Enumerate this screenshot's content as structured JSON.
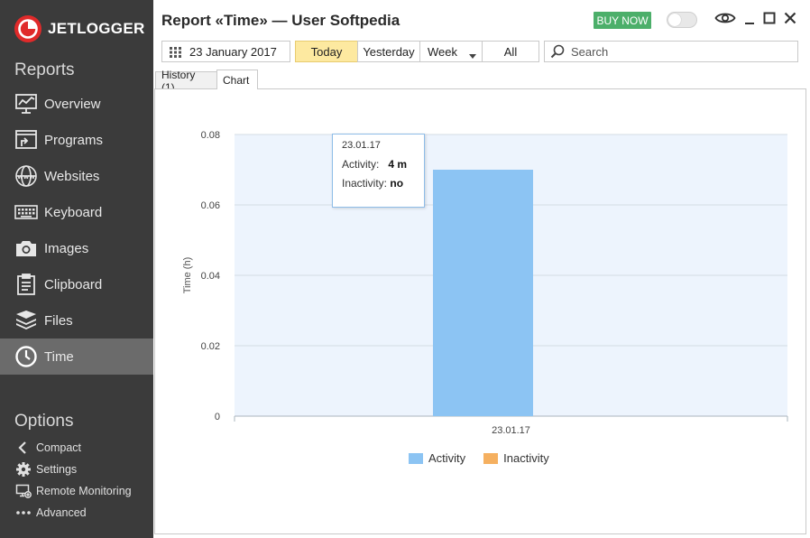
{
  "app": {
    "brand": "JETLOGGER",
    "window_title": "Report «Time» — User Softpedia",
    "buy_now": "BUY NOW"
  },
  "sidebar": {
    "reports_title": "Reports",
    "items": [
      {
        "label": "Overview",
        "icon": "overview-icon",
        "active": false
      },
      {
        "label": "Programs",
        "icon": "programs-icon",
        "active": false
      },
      {
        "label": "Websites",
        "icon": "websites-icon",
        "active": false
      },
      {
        "label": "Keyboard",
        "icon": "keyboard-icon",
        "active": false
      },
      {
        "label": "Images",
        "icon": "camera-icon",
        "active": false
      },
      {
        "label": "Clipboard",
        "icon": "clipboard-icon",
        "active": false
      },
      {
        "label": "Files",
        "icon": "files-icon",
        "active": false
      },
      {
        "label": "Time",
        "icon": "clock-icon",
        "active": true
      }
    ],
    "options_title": "Options",
    "options": [
      {
        "label": "Compact",
        "icon": "chevron-left-icon"
      },
      {
        "label": "Settings",
        "icon": "gear-icon"
      },
      {
        "label": "Remote Monitoring",
        "icon": "remote-monitor-icon"
      },
      {
        "label": "Advanced",
        "icon": "more-icon"
      }
    ]
  },
  "toolbar": {
    "date": "23 January 2017",
    "periods": [
      "Today",
      "Yesterday",
      "Week",
      "All"
    ],
    "selected_period": "Today",
    "search_placeholder": "Search"
  },
  "tabs": [
    {
      "label": "History (1)",
      "active": false
    },
    {
      "label": "Chart",
      "active": true
    }
  ],
  "tooltip": {
    "date": "23.01.17",
    "activity_label": "Activity:",
    "activity_value": "4 m",
    "inactivity_label": "Inactivity:",
    "inactivity_value": "no"
  },
  "colors": {
    "sidebar_bg": "#3b3b3b",
    "active_item": "#6b6b6b",
    "accent_red": "#e02a2a",
    "buy_now_green": "#4caf6a",
    "today_highlight": "#fde9a0",
    "activity": "#8cc4f3",
    "inactivity": "#f5b060",
    "plot_bg": "#edf4fd"
  },
  "chart_data": {
    "type": "bar",
    "categories": [
      "23.01.17"
    ],
    "series": [
      {
        "name": "Activity",
        "values": [
          0.07
        ],
        "color": "#8cc4f3"
      },
      {
        "name": "Inactivity",
        "values": [
          0
        ],
        "color": "#f5b060"
      }
    ],
    "title": "",
    "xlabel": "",
    "ylabel": "Time (h)",
    "ylim": [
      0,
      0.08
    ],
    "yticks": [
      0,
      0.02,
      0.04,
      0.06,
      0.08
    ],
    "ytick_labels": [
      "0",
      "0.02",
      "0.04",
      "0.06",
      "0.08"
    ],
    "grid": true,
    "legend": "bottom"
  }
}
